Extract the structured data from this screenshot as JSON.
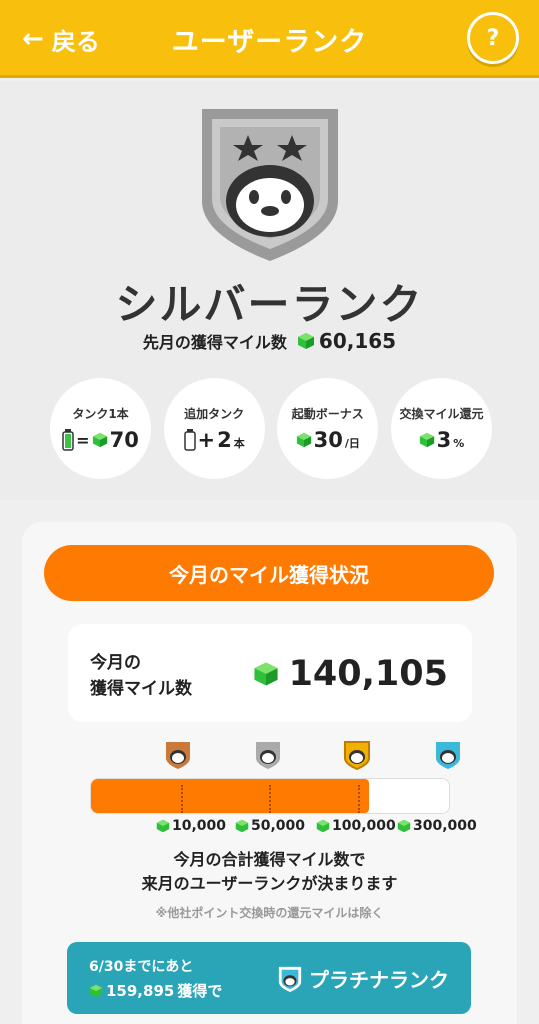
{
  "header": {
    "back_label": "戻る",
    "title": "ユーザーランク",
    "help_label": "?",
    "accent": "#f8c00c"
  },
  "rank": {
    "name": "シルバーランク",
    "last_month_label": "先月の獲得マイル数",
    "last_month_value": "60,165",
    "badge_icon": "penguin-shield-silver-icon"
  },
  "perks": [
    {
      "label": "タンク1本",
      "prefix": "=",
      "value": "70",
      "unit": "",
      "icon": "battery-icon"
    },
    {
      "label": "追加タンク",
      "prefix": "+",
      "value": "2",
      "unit": "本",
      "icon": "empty-battery-icon"
    },
    {
      "label": "起動ボーナス",
      "prefix": "",
      "value": "30",
      "unit": "/日",
      "icon": "gem-icon"
    },
    {
      "label": "交換マイル還元",
      "prefix": "",
      "value": "3",
      "unit": "%",
      "icon": "gem-icon"
    }
  ],
  "status": {
    "button_label": "今月のマイル獲得状況",
    "miles_label_line1": "今月の",
    "miles_label_line2": "獲得マイル数",
    "miles_value": "140,105",
    "progress_fraction": 0.78,
    "thresholds": [
      "10,000",
      "50,000",
      "100,000",
      "300,000"
    ],
    "tiers": [
      "bronze",
      "silver",
      "gold",
      "platinum"
    ],
    "note_line1": "今月の合計獲得マイル数で",
    "note_line2": "来月のユーザーランクが決まります",
    "note_sub": "※他社ポイント交換時の還元マイルは除く",
    "orange": "#ff7a00"
  },
  "next": {
    "line1": "6/30までにあと",
    "miles": "159,895",
    "suffix": "獲得で",
    "rank_name": "プラチナランク",
    "teal": "#2aa5b8"
  }
}
